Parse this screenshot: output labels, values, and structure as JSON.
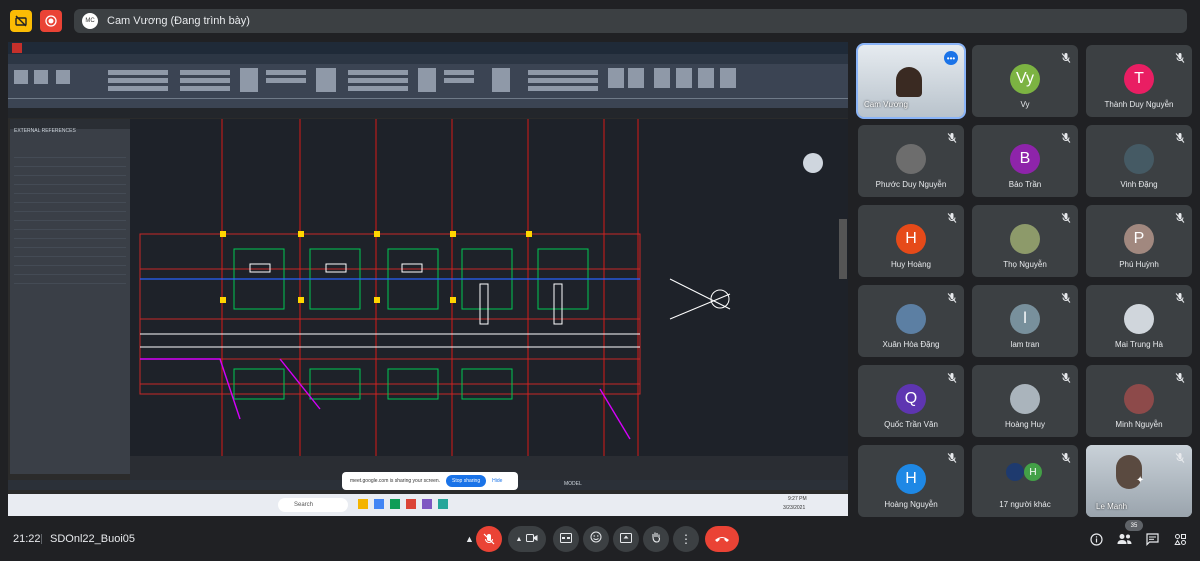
{
  "header": {
    "presenter_avatar": "MC",
    "presenter_label": "Cam Vương (Đang trình bày)"
  },
  "shared_screen": {
    "app": "AutoCAD",
    "panel_title": "EXTERNAL REFERENCES",
    "share_popup": {
      "text": "meet.google.com is sharing your screen.",
      "stop_label": "Stop sharing",
      "hide_label": "Hide"
    },
    "status_model": "MODEL",
    "taskbar_search": "Search",
    "taskbar_time": "9:27 PM",
    "taskbar_date": "3/23/2021"
  },
  "participants": [
    {
      "name": "Cam Vương",
      "initial": "",
      "color": "#cfd6de",
      "type": "me"
    },
    {
      "name": "Vy",
      "initial": "Vy",
      "color": "#7cb342",
      "type": "letter"
    },
    {
      "name": "Thành Duy Nguyễn",
      "initial": "T",
      "color": "#e91e63",
      "type": "letter"
    },
    {
      "name": "Phước Duy Nguyễn",
      "initial": "",
      "color": "#6d6d6d",
      "type": "photo"
    },
    {
      "name": "Bảo Trần",
      "initial": "B",
      "color": "#8e24aa",
      "type": "letter"
    },
    {
      "name": "Vinh Đặng",
      "initial": "",
      "color": "#455a64",
      "type": "photo"
    },
    {
      "name": "Huy Hoàng",
      "initial": "H",
      "color": "#e64a19",
      "type": "letter"
    },
    {
      "name": "Thọ Nguyễn",
      "initial": "",
      "color": "#8d9a6a",
      "type": "photo"
    },
    {
      "name": "Phú Huỳnh",
      "initial": "P",
      "color": "#a1887f",
      "type": "letter"
    },
    {
      "name": "Xuân Hòa Đặng",
      "initial": "",
      "color": "#5c7fa3",
      "type": "photo"
    },
    {
      "name": "lam tran",
      "initial": "l",
      "color": "#78909c",
      "type": "letter"
    },
    {
      "name": "Mai Trung Hà",
      "initial": "",
      "color": "#d0d6dc",
      "type": "photo"
    },
    {
      "name": "Quốc Trần Văn",
      "initial": "Q",
      "color": "#5e35b1",
      "type": "letter"
    },
    {
      "name": "Hoàng Huy",
      "initial": "",
      "color": "#aab4bc",
      "type": "photo"
    },
    {
      "name": "Minh Nguyễn",
      "initial": "",
      "color": "#8d4a4a",
      "type": "photo"
    },
    {
      "name": "Hoàng Nguyễn",
      "initial": "H",
      "color": "#1e88e5",
      "type": "letter"
    },
    {
      "name": "17 người khác",
      "initial": "H",
      "color": "#43a047",
      "type": "others"
    },
    {
      "name": "Le Manh",
      "initial": "",
      "color": "#b7c0c8",
      "type": "cam"
    }
  ],
  "bottom_bar": {
    "time": "21:22",
    "meeting_code": "SDOnl22_Buoi05",
    "people_count": "35"
  },
  "icons": {
    "top_left_1": "captions-off-icon",
    "top_left_2": "record-icon",
    "mic": "mic-off-icon",
    "camera": "camera-icon",
    "captions": "captions-icon",
    "emoji": "emoji-icon",
    "present": "present-icon",
    "hand": "raise-hand-icon",
    "more": "more-options-icon",
    "leave": "leave-call-icon",
    "info": "info-icon",
    "people": "people-icon",
    "chat": "chat-icon",
    "activities": "activities-icon"
  },
  "colors": {
    "background": "#202124",
    "tile": "#3c4043",
    "leave_red": "#ea4335",
    "accent_blue": "#1a73e8"
  }
}
